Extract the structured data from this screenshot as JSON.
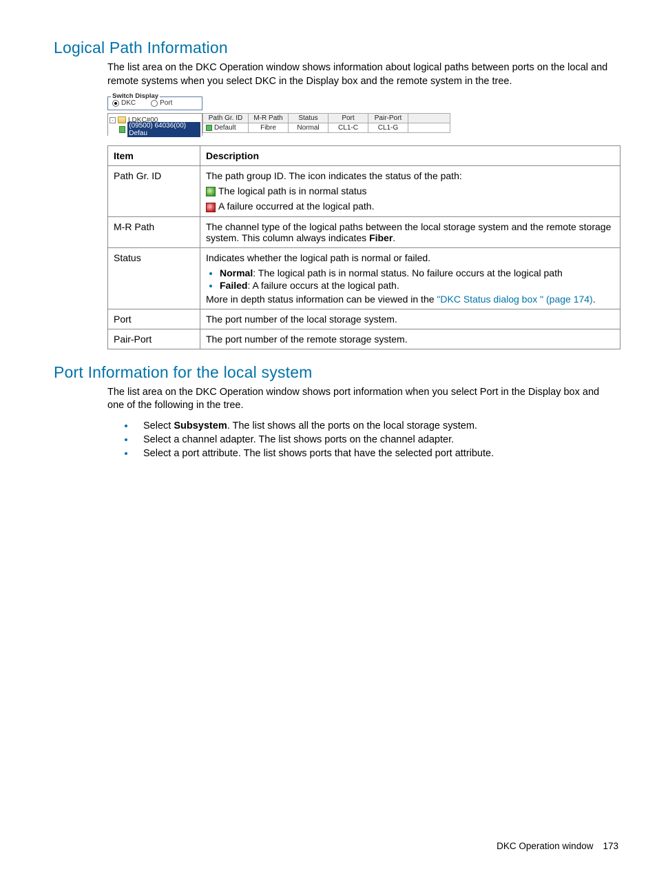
{
  "section1": {
    "heading": "Logical Path Information",
    "intro": "The list area on the DKC Operation window shows information about logical paths between ports on the local and remote systems when you select DKC in the Display box and the remote system in the tree."
  },
  "figure": {
    "switch_legend": "Switch Display",
    "radio_dkc": "DKC",
    "radio_port": "Port",
    "tree_root": "LDKC#00",
    "tree_child": "(09500) 64036(00) Defau",
    "grid": {
      "headers": [
        "Path Gr. ID",
        "M-R Path",
        "Status",
        "Port",
        "Pair-Port",
        ""
      ],
      "row": [
        "Default",
        "Fibre",
        "Normal",
        "CL1-C",
        "CL1-G",
        ""
      ]
    }
  },
  "desc_table": {
    "head_item": "Item",
    "head_desc": "Description",
    "rows": {
      "pathgr": {
        "item": "Path Gr. ID",
        "line1": "The path group ID. The icon indicates the status of the path:",
        "line2": "The logical path is in normal status",
        "line3": "A failure occurred at the logical path."
      },
      "mrpath": {
        "item": "M-R Path",
        "desc_a": "The channel type of the logical paths between the local storage system and the remote storage system. This column always indicates ",
        "desc_b": "Fiber",
        "desc_c": "."
      },
      "status": {
        "item": "Status",
        "line1": "Indicates whether the logical path is normal or failed.",
        "bullet1a": "Normal",
        "bullet1b": ": The logical path is in normal status. No failure occurs at the logical path",
        "bullet2a": "Failed",
        "bullet2b": ": A failure occurs at the logical path.",
        "line2a": "More in depth status information can be viewed in the ",
        "link": "\"DKC Status dialog box \" (page 174)",
        "line2b": "."
      },
      "port": {
        "item": "Port",
        "desc": "The port number of the local storage system."
      },
      "pairport": {
        "item": "Pair-Port",
        "desc": "The port number of the remote storage system."
      }
    }
  },
  "section2": {
    "heading": "Port Information for the local system",
    "intro": "The list area on the DKC Operation window shows port information when you select Port in the Display box and one of the following in the tree.",
    "bullets": {
      "b1a": "Select ",
      "b1b": "Subsystem",
      "b1c": ". The list shows all the ports on the local storage system.",
      "b2": "Select a channel adapter. The list shows ports on the channel adapter.",
      "b3": "Select a port attribute. The list shows ports that have the selected port attribute."
    }
  },
  "footer": {
    "label": "DKC Operation window",
    "page": "173"
  }
}
